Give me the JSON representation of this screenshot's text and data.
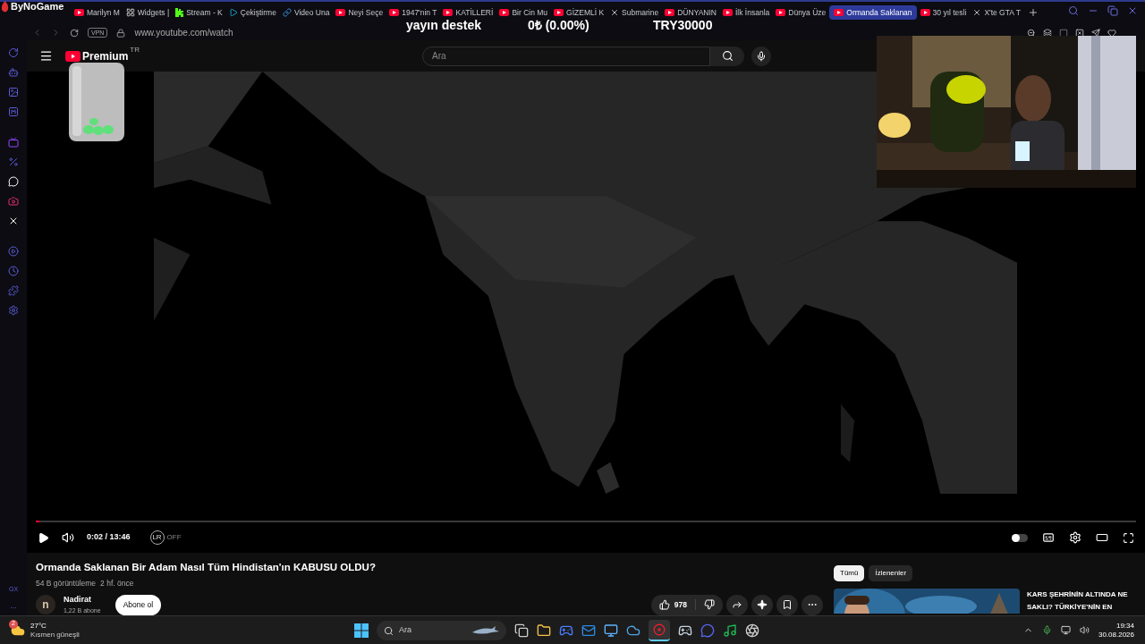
{
  "overlay": {
    "brand": "ByNoGame",
    "donation_label": "yayın destek",
    "donation_amount": "0₺ (0.00%)",
    "donation_goal": "TRY30000"
  },
  "tabs": [
    {
      "label": "Marilyn M",
      "kind": "video",
      "selected": false
    },
    {
      "label": "Widgets |",
      "kind": "widget",
      "selected": false
    },
    {
      "label": "Stream - K",
      "kind": "kick",
      "selected": false
    },
    {
      "label": "Çekiştirme",
      "kind": "vimeo",
      "selected": false
    },
    {
      "label": "Video Una",
      "kind": "link",
      "selected": false
    },
    {
      "label": "Neyi Seçe",
      "kind": "video",
      "selected": false
    },
    {
      "label": "1947'nin T",
      "kind": "video",
      "selected": false
    },
    {
      "label": "KATİLLERİ",
      "kind": "video",
      "selected": false
    },
    {
      "label": "Bir Cin Mu",
      "kind": "video",
      "selected": false
    },
    {
      "label": "GİZEMLİ K",
      "kind": "video",
      "selected": false
    },
    {
      "label": "Submarine",
      "kind": "x",
      "selected": false
    },
    {
      "label": "DÜNYANIN",
      "kind": "video",
      "selected": false
    },
    {
      "label": "İlk İnsanla",
      "kind": "video",
      "selected": false
    },
    {
      "label": "Dünya Üze",
      "kind": "video",
      "selected": false
    },
    {
      "label": "Ormanda Saklanan",
      "kind": "video",
      "selected": true
    },
    {
      "label": "30 yıl tesli",
      "kind": "video",
      "selected": false
    },
    {
      "label": "X'te GTA T",
      "kind": "x",
      "selected": false
    }
  ],
  "address": {
    "vpn": "VPN",
    "url": "www.youtube.com/watch"
  },
  "sidebar": {
    "gx": "GX",
    "more": "..."
  },
  "youtube": {
    "logo": "Premium",
    "region": "TR",
    "search_placeholder": "Ara"
  },
  "player": {
    "autoplay": false,
    "level": 0.003,
    "time": "0:02 / 13:46",
    "lr_icon": "LR",
    "lr_state": "OFF"
  },
  "video": {
    "title": "Ormanda Saklanan Bir Adam Nasıl Tüm Hindistan'ın KABUSU OLDU?",
    "views": "54 B görüntüleme",
    "age": "2 hf. önce",
    "channel": "Nadirat",
    "avatar": "n",
    "subscribers": "1,22 B abone",
    "subscribe": "Abone ol",
    "likes": "978"
  },
  "filters": [
    {
      "label": "Tümü",
      "selected": true
    },
    {
      "label": "İzlenenler",
      "selected": false
    }
  ],
  "recommendation": {
    "title": "KARS ŞEHRİNİN ALTINDA NE SAKLI? TÜRKİYE'NİN EN"
  },
  "taskbar": {
    "weather_badge": "2",
    "temperature": "27°C",
    "weather": "Kısmen güneşli",
    "search_placeholder": "Ara",
    "time": "19:34",
    "date": "30.08.2026"
  }
}
